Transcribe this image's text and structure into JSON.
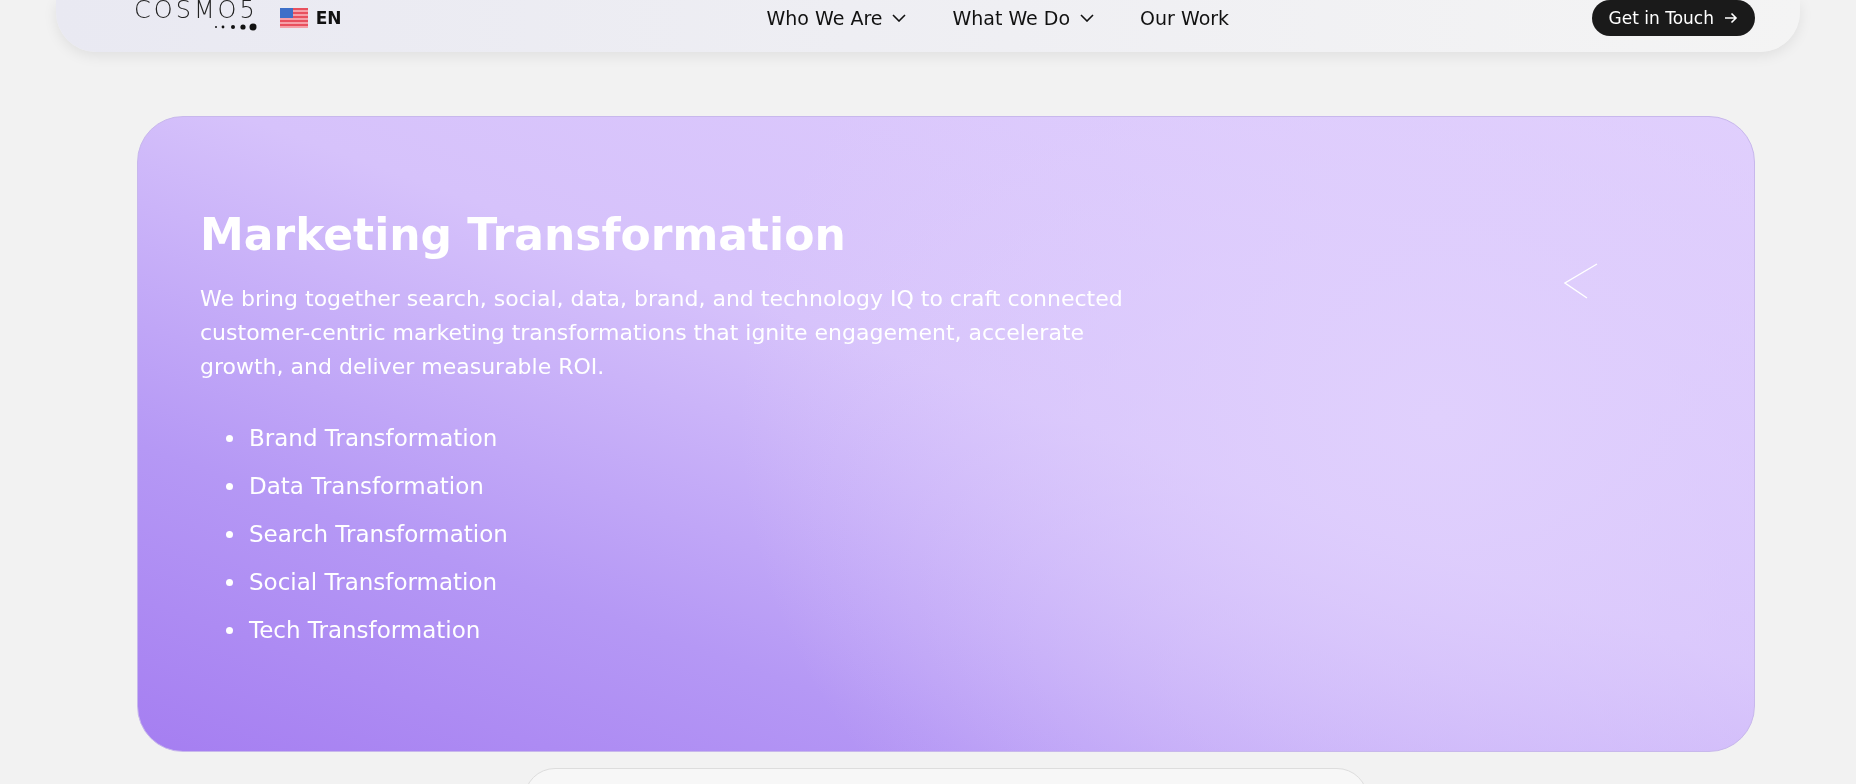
{
  "header": {
    "logo": "COSMO5",
    "language": "EN",
    "nav": [
      {
        "label": "Who We Are",
        "dropdown": true
      },
      {
        "label": "What We Do",
        "dropdown": true
      },
      {
        "label": "Our Work",
        "dropdown": false
      }
    ],
    "cta": "Get in Touch"
  },
  "hero": {
    "title": "Marketing Transformation",
    "description": "We bring together search, social, data, brand, and technology IQ to craft connected customer-centric marketing transformations that ignite engagement, accelerate growth, and deliver measurable ROI.",
    "items": [
      "Brand Transformation",
      "Data Transformation",
      "Search Transformation",
      "Social Transformation",
      "Tech Transformation"
    ]
  }
}
